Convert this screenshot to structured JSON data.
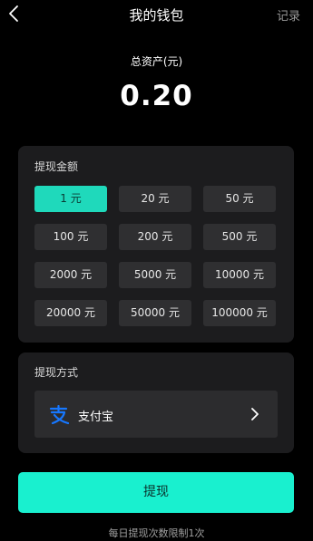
{
  "header": {
    "title": "我的钱包",
    "right_link": "记录",
    "back_icon": "chevron-left-icon"
  },
  "assets": {
    "label": "总资产(元)",
    "value": "0.20"
  },
  "withdraw_amount": {
    "title": "提现金额",
    "selected_index": 0,
    "options": [
      "1 元",
      "20 元",
      "50 元",
      "100 元",
      "200 元",
      "500 元",
      "2000 元",
      "5000 元",
      "10000 元",
      "20000 元",
      "50000 元",
      "100000 元"
    ]
  },
  "withdraw_method": {
    "title": "提现方式",
    "method_label": "支付宝",
    "method_icon": "alipay-icon",
    "chevron_icon": "chevron-right-icon"
  },
  "actions": {
    "withdraw_label": "提现"
  },
  "footer": {
    "limit_note": "每日提现次数限制1次"
  },
  "colors": {
    "accent": "#19f0cf",
    "selected": "#1fd9bb",
    "alipay_blue": "#1677ff",
    "card_bg": "#1c1c1e",
    "page_bg": "#000000"
  }
}
